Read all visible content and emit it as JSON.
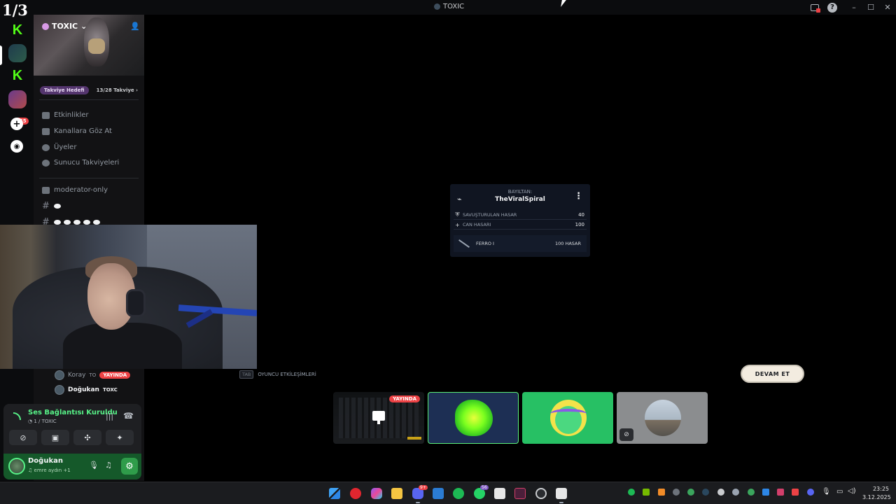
{
  "overlay": {
    "page_counter": "1/3"
  },
  "window": {
    "title": "TOXIC",
    "accent": "#5865f2"
  },
  "rail": {
    "notification_badge": "865"
  },
  "server": {
    "name": "TOXIC",
    "boost_tag": "Takviye Hedefi",
    "boost_progress": "13/28 Takviye",
    "menu": [
      {
        "label": "Etkinlikler",
        "icon": "calendar-icon"
      },
      {
        "label": "Kanallara Göz At",
        "icon": "browse-channels-icon"
      },
      {
        "label": "Üyeler",
        "icon": "members-icon"
      },
      {
        "label": "Sunucu Takviyeleri",
        "icon": "boost-icon"
      }
    ],
    "channels": [
      {
        "label": "moderator-only",
        "icon": "rules-icon"
      }
    ]
  },
  "voice_members": [
    {
      "name": "Koray",
      "tag": "TO",
      "badge": "YAYINDA"
    },
    {
      "name": "Doğukan",
      "tag": "TOXC"
    }
  ],
  "voice_panel": {
    "status": "Ses Bağlantısı Kuruldu",
    "channel": "1 / TOXIC",
    "user_name": "Doğukan",
    "user_status": "emre aydın +1"
  },
  "recap": {
    "label": "BAYILTAN:",
    "killer": "TheViralSpiral",
    "rows": [
      {
        "label": "SAVUŞTURULAN HASAR",
        "value": "40",
        "icon": "shield-icon"
      },
      {
        "label": "CAN HASARI",
        "value": "100",
        "icon": "plus-icon"
      }
    ],
    "weapon": {
      "name": "FERRO I",
      "damage": "100 HASAR"
    }
  },
  "hint": {
    "key": "TAB",
    "label": "OYUNCU ETKİLEŞİMLERİ"
  },
  "continue_button": "DEVAM ET",
  "stream_tiles": [
    {
      "kind": "screen-share",
      "badge": "YAYINDA"
    },
    {
      "kind": "avatar-green-blob",
      "selected": true
    },
    {
      "kind": "avatar-cartoon"
    },
    {
      "kind": "avatar-photo",
      "camera_off": true
    }
  ],
  "taskbar": {
    "time": "23:25",
    "date": "3.12.2025",
    "badges": {
      "discord": "9+",
      "whatsapp": "56"
    }
  }
}
